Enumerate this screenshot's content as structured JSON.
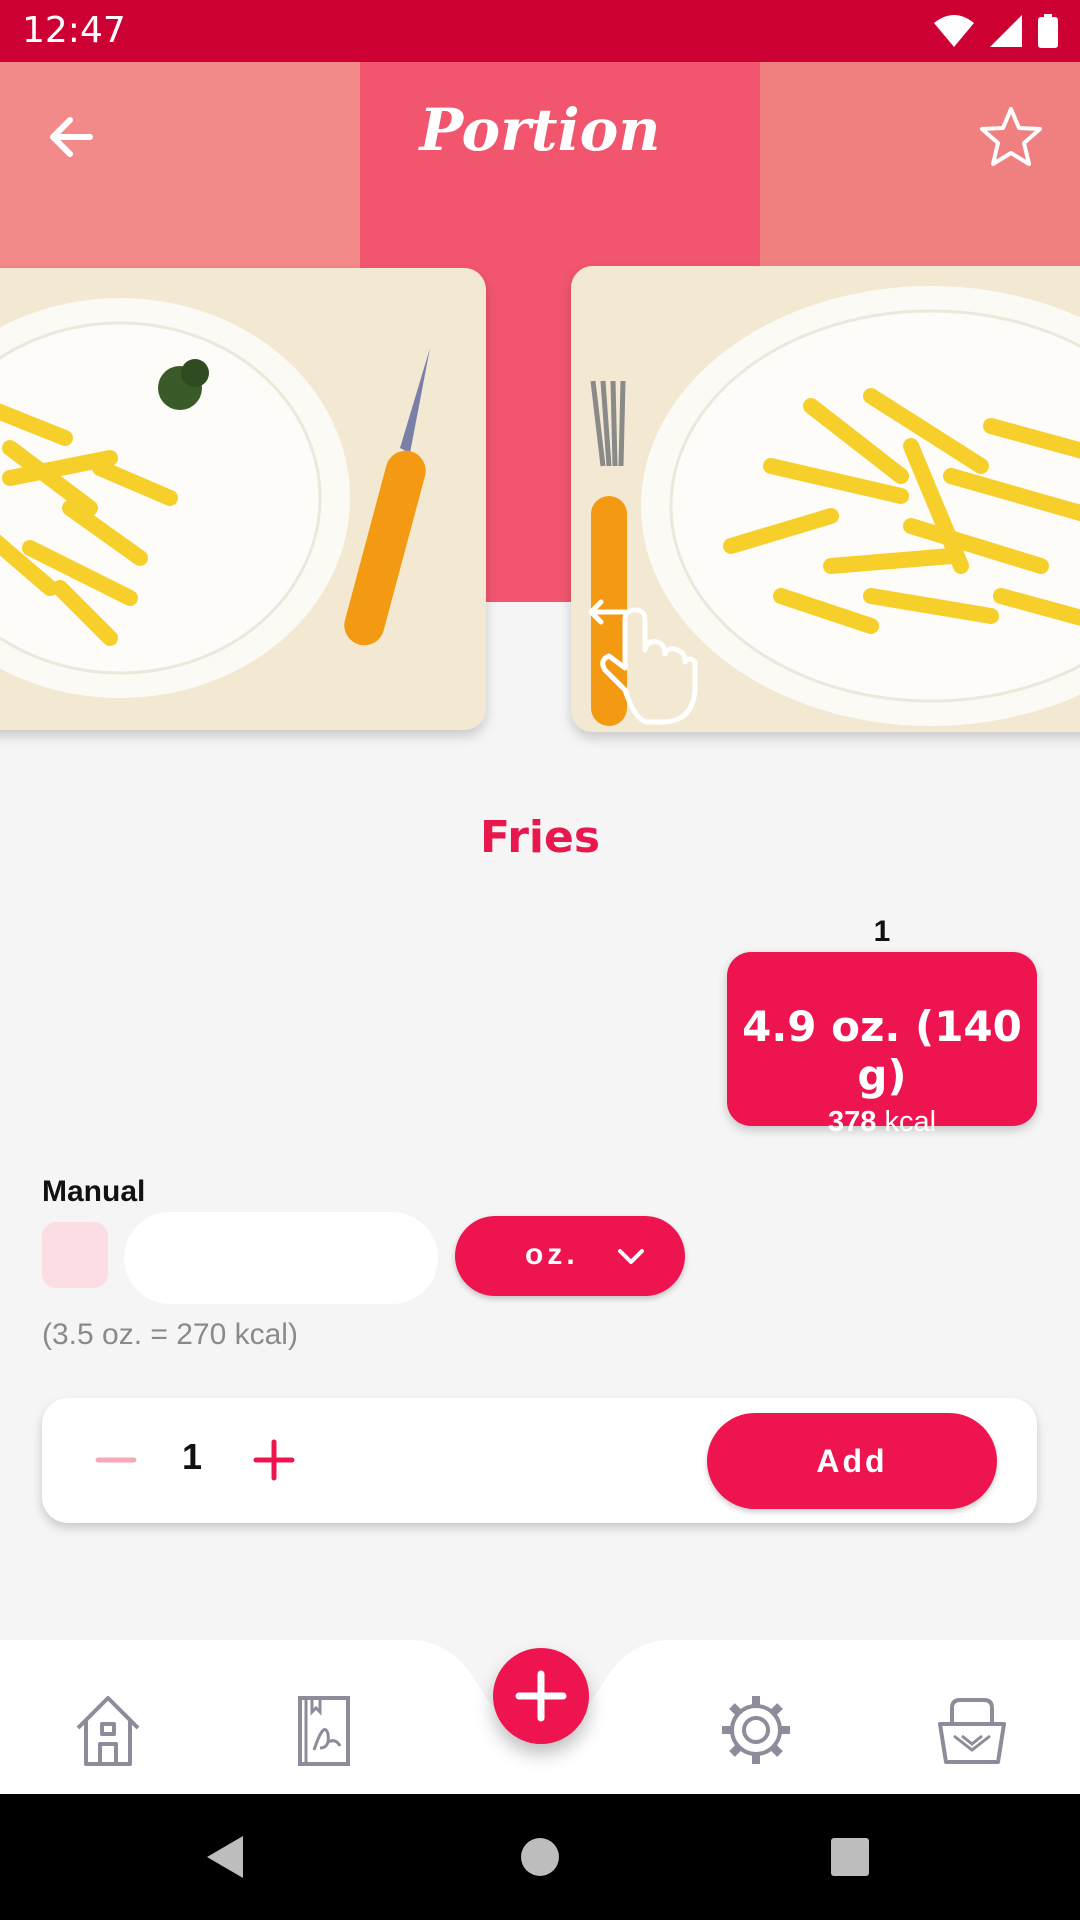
{
  "status_bar": {
    "time": "12:47"
  },
  "header": {
    "title": "Portion"
  },
  "food": {
    "name": "Fries"
  },
  "portion": {
    "index": "1",
    "amount": "4.9 oz. (140 g)",
    "kcal_value": "378",
    "kcal_unit": "kcal"
  },
  "manual": {
    "label": "Manual",
    "input_value": "",
    "unit": "oz.",
    "reference": "(3.5 oz. = 270 kcal)"
  },
  "quantity": {
    "value": "1",
    "add_label": "Add"
  },
  "bottom_nav": {
    "items": [
      "home-icon",
      "recipe-book-icon",
      "add-icon",
      "settings-icon",
      "basket-icon"
    ]
  },
  "colors": {
    "accent": "#ee1450",
    "status_bar": "#cc0033",
    "header_center": "#f2566e",
    "header_side": "#f08080"
  }
}
